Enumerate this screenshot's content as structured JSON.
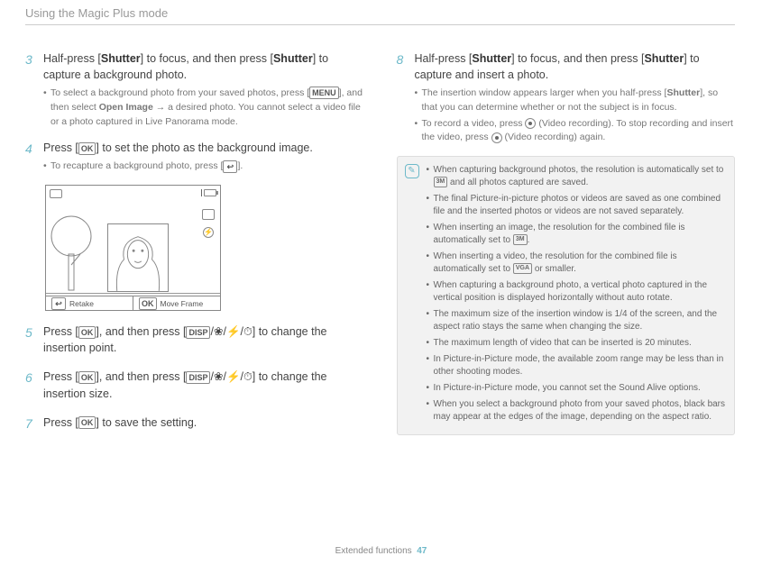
{
  "header": "Using the Magic Plus mode",
  "icons": {
    "ok": "OK",
    "menu": "MENU",
    "disp": "DISP",
    "back": "↩",
    "res3m": "3M",
    "resVga": "VGA",
    "flower": "❀",
    "bolt": "⚡",
    "timer": "⏱"
  },
  "left": {
    "step3": {
      "textA": "Half-press [",
      "shutter": "Shutter",
      "textB": "] to focus, and then press [",
      "textC": "] to capture a background photo.",
      "bulletA1": "To select a background photo from your saved photos, press [",
      "bulletA2": "], and then select ",
      "openImage": "Open Image",
      "bulletA3": " → a desired photo. You cannot select a video file or a photo captured in Live Panorama mode."
    },
    "step4": {
      "textA": "Press [",
      "textB": "] to set the photo as the background image.",
      "bulletA1": "To recapture a background photo, press [",
      "bulletA2": "]."
    },
    "preview": {
      "retake": "Retake",
      "moveFrame": "Move Frame"
    },
    "step5": {
      "textA": "Press [",
      "textB": "], and then press [",
      "textC": "] to change the insertion point."
    },
    "step6": {
      "textA": "Press [",
      "textB": "], and then press [",
      "textC": "] to change the insertion size."
    },
    "step7": {
      "textA": "Press [",
      "textB": "] to save the setting."
    }
  },
  "right": {
    "step8": {
      "textA": "Half-press [",
      "shutter": "Shutter",
      "textB": "] to focus, and then press [",
      "textC": "] to capture and insert a photo.",
      "bulletA1": "The insertion window appears larger when you half-press [",
      "bulletA2": "], so that you can determine whether or not the subject is in focus.",
      "bulletB1": "To record a video, press ",
      "videoRec": " (Video recording). To stop recording and insert the video, press ",
      "bulletB2": " (Video recording) again."
    },
    "notes": {
      "n1a": "When capturing background photos, the resolution is automatically set to ",
      "n1b": " and all photos captured are saved.",
      "n2": "The final Picture-in-picture photos or videos are saved as one combined file and the inserted photos or videos are not saved separately.",
      "n3a": "When inserting an image, the resolution for the combined file is automatically set to ",
      "n3b": ".",
      "n4a": "When inserting a video, the resolution for the combined file is automatically set to ",
      "n4b": " or smaller.",
      "n5": "When capturing a background photo, a vertical photo captured in the vertical position is displayed horizontally without auto rotate.",
      "n6": "The maximum size of the insertion window is 1/4 of the screen, and the aspect ratio stays the same when changing the size.",
      "n7": "The maximum length of video that can be inserted is 20 minutes.",
      "n8": "In Picture-in-Picture mode, the available zoom range may be less than in other shooting modes.",
      "n9": "In Picture-in-Picture mode, you cannot set the Sound Alive options.",
      "n10": "When you select a background photo from your saved photos, black bars may appear at the edges of the image, depending on the aspect ratio."
    }
  },
  "footer": {
    "section": "Extended functions",
    "page": "47"
  }
}
